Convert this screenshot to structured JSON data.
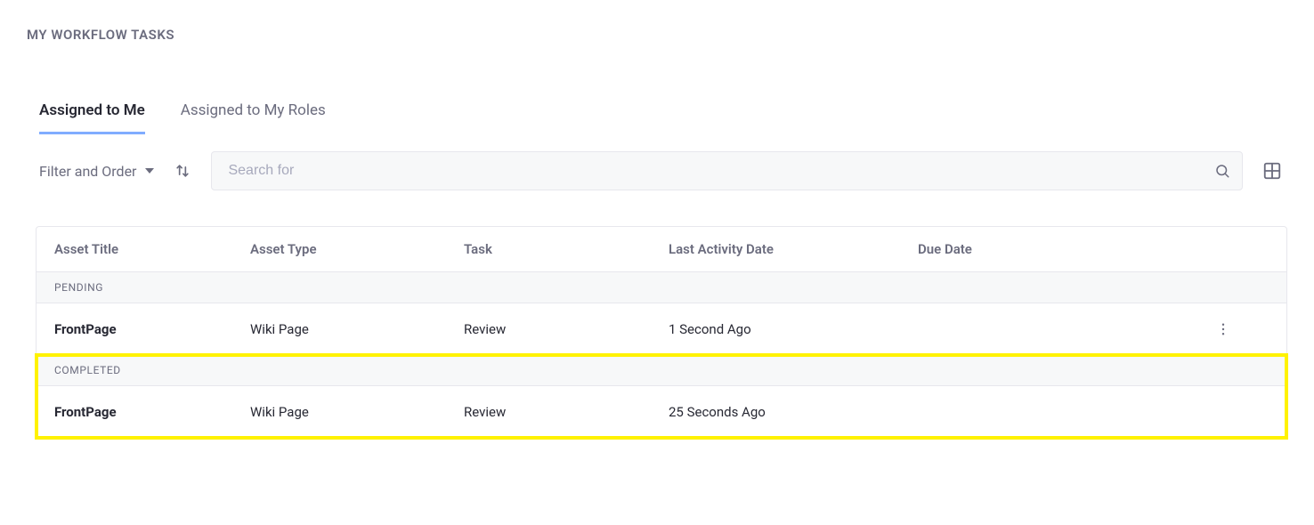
{
  "page_title": "MY WORKFLOW TASKS",
  "tabs": [
    {
      "label": "Assigned to Me",
      "active": true
    },
    {
      "label": "Assigned to My Roles",
      "active": false
    }
  ],
  "toolbar": {
    "filter_order_label": "Filter and Order",
    "search_placeholder": "Search for"
  },
  "columns": {
    "asset_title": "Asset Title",
    "asset_type": "Asset Type",
    "task": "Task",
    "last_activity": "Last Activity Date",
    "due_date": "Due Date"
  },
  "groups": [
    {
      "name": "PENDING",
      "highlight": false,
      "rows": [
        {
          "asset_title": "FrontPage",
          "asset_type": "Wiki Page",
          "task": "Review",
          "last_activity": "1 Second Ago",
          "due_date": "",
          "has_actions": true
        }
      ]
    },
    {
      "name": "COMPLETED",
      "highlight": true,
      "rows": [
        {
          "asset_title": "FrontPage",
          "asset_type": "Wiki Page",
          "task": "Review",
          "last_activity": "25 Seconds Ago",
          "due_date": "",
          "has_actions": false
        }
      ]
    }
  ]
}
